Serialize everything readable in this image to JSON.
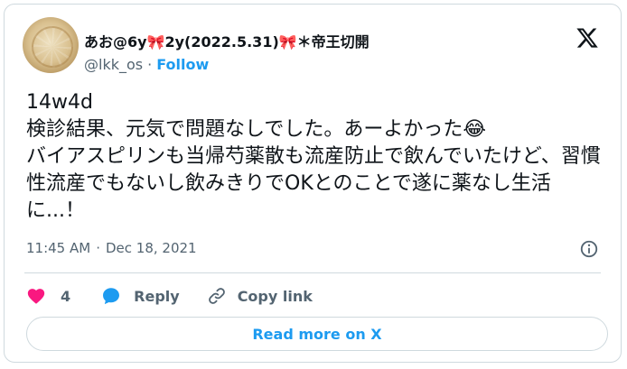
{
  "tweet": {
    "author": {
      "display_name": "あお@6y🎀2y(2022.5.31)🎀＊帝王切開",
      "handle": "@lkk_os",
      "follow_label": "Follow",
      "separator": "·"
    },
    "text": "14w4d\n検診結果、元気で問題なしでした。あーよかった😂\nバイアスピリンも当帰芍薬散も流産防止で飲んでいたけど、習慣性流産でもないし飲みきりでOKとのことで遂に薬なし生活に...！",
    "time": "11:45 AM",
    "date": "Dec 18, 2021",
    "actions": {
      "like_count": "4",
      "reply_label": "Reply",
      "copy_link_label": "Copy link"
    },
    "read_more_label": "Read more on X"
  },
  "colors": {
    "accent": "#1d9bf0",
    "like": "#f91880",
    "muted": "#536471",
    "border": "#cfd9de"
  },
  "icons": {
    "brand": "x-logo-icon",
    "info": "info-icon",
    "like": "heart-icon",
    "reply": "speech-bubble-icon",
    "copy_link": "link-icon"
  }
}
